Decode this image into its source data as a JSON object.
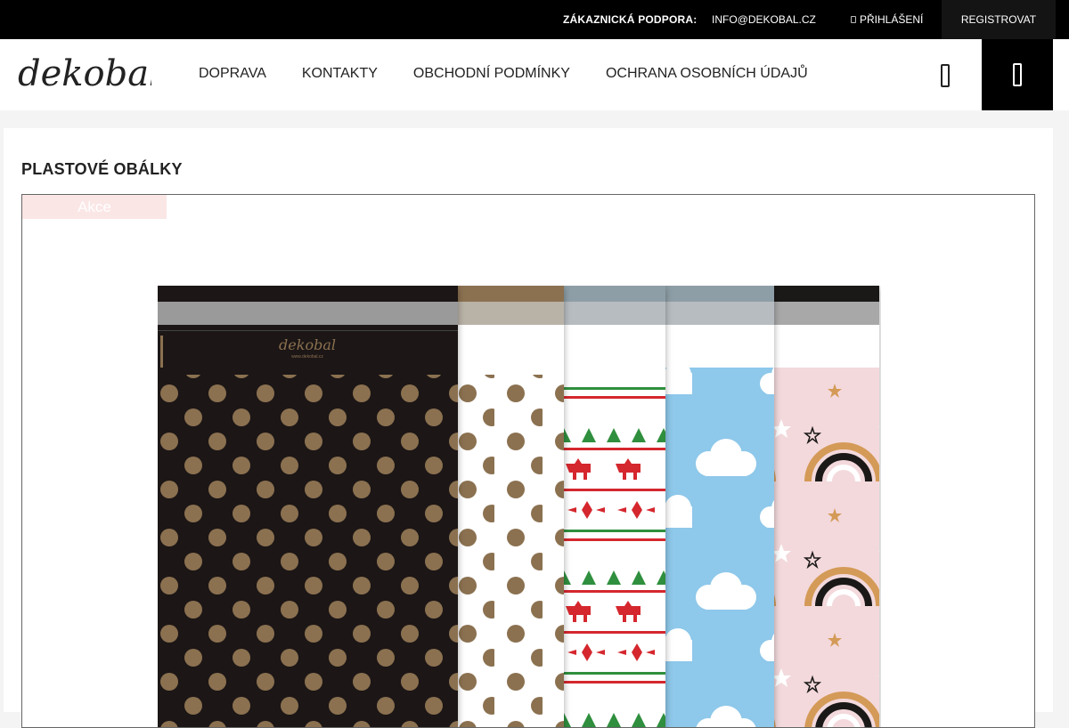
{
  "topbar": {
    "support_label": "ZÁKAZNICKÁ PODPORA:",
    "support_email": "INFO@DEKOBAL.CZ",
    "login_label": "PŘIHLÁŠENÍ",
    "register_label": "REGISTROVAT"
  },
  "header": {
    "logo_text": "dekobal",
    "nav": [
      "DOPRAVA",
      "KONTAKTY",
      "OBCHODNÍ PODMÍNKY",
      "OCHRANA OSOBNÍCH ÚDAJŮ"
    ],
    "search_icon": "search-icon",
    "cart_icon": "cart-icon"
  },
  "main": {
    "page_title": "PLASTOVÉ OBÁLKY",
    "product": {
      "badge": "Akce",
      "envelope_logo": "dekobal",
      "envelope_url": "www.dekobal.cz",
      "colors": {
        "black": "#1b1918",
        "gold": "#8b7150",
        "sky": "#8ec8ea",
        "pink": "#f3d9dc",
        "red": "#d5272e",
        "green": "#2f8f3e"
      }
    }
  }
}
